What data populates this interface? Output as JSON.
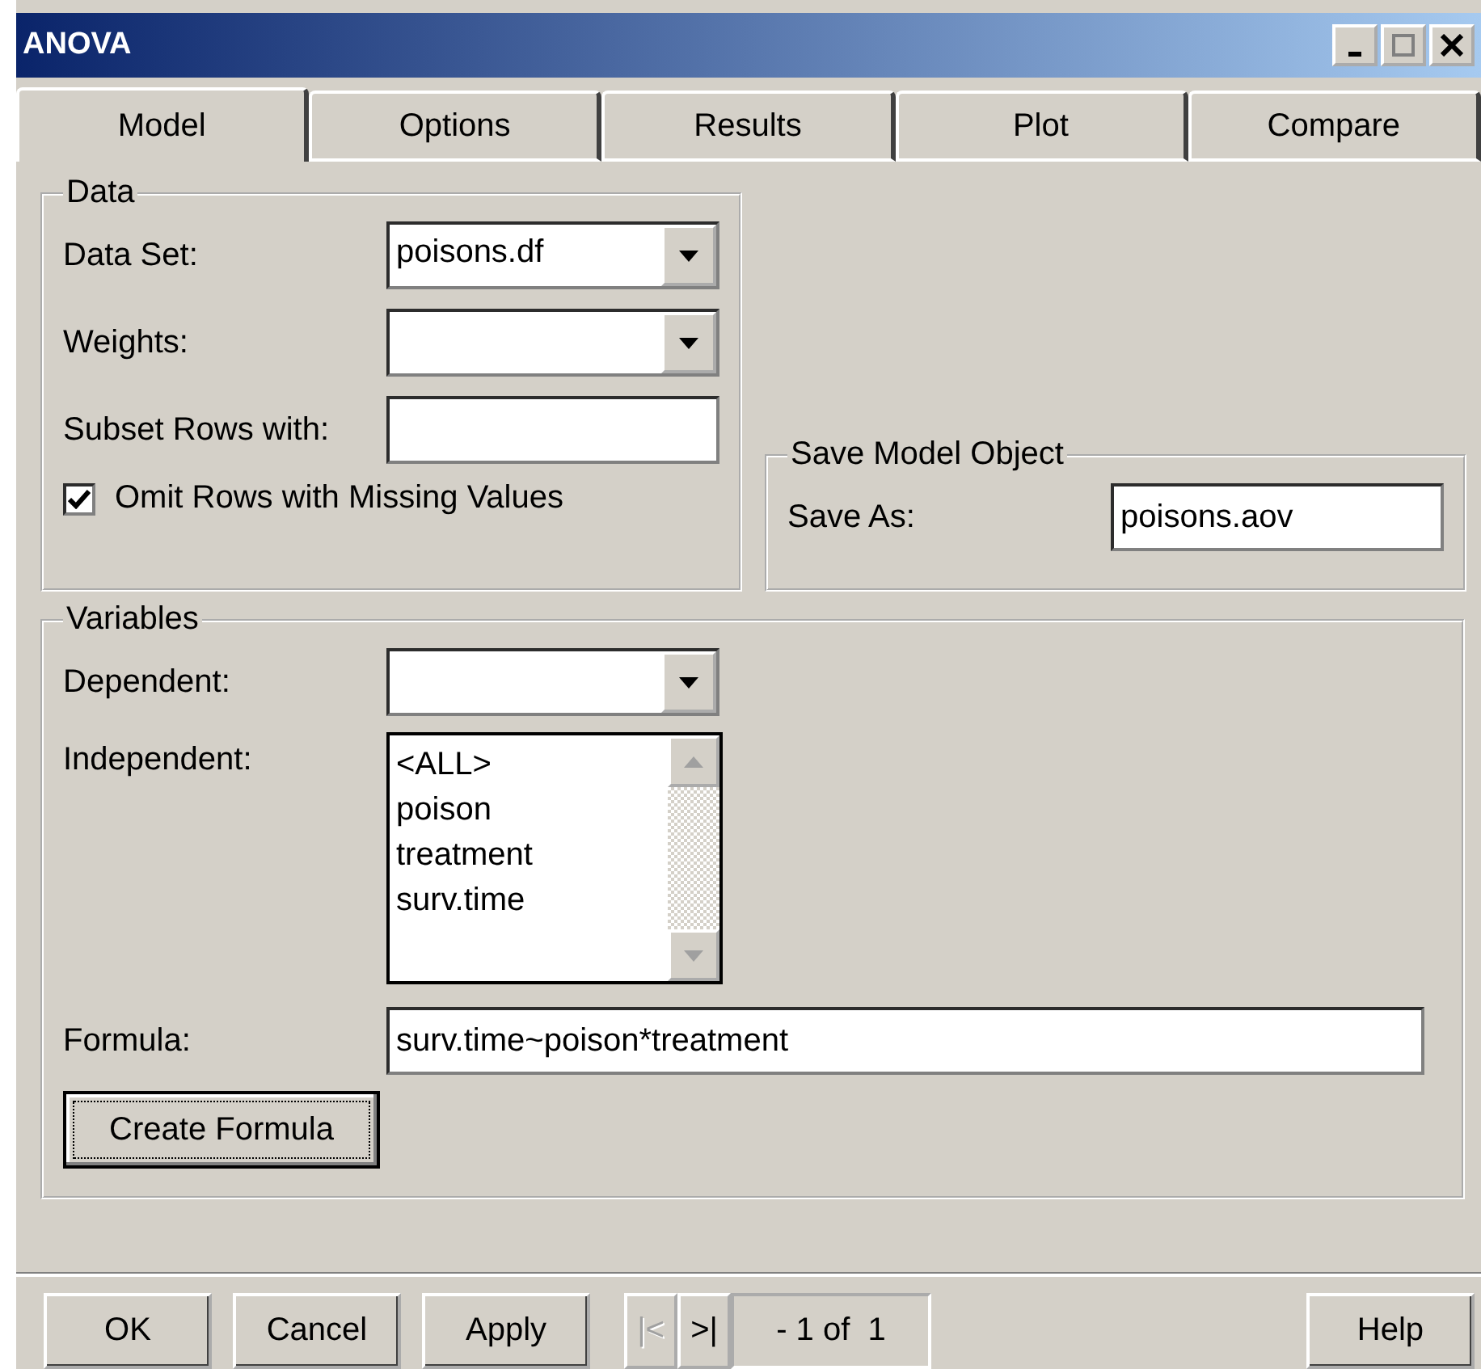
{
  "window": {
    "title": "ANOVA"
  },
  "tabs": [
    {
      "label": "Model",
      "selected": true
    },
    {
      "label": "Options",
      "selected": false
    },
    {
      "label": "Results",
      "selected": false
    },
    {
      "label": "Plot",
      "selected": false
    },
    {
      "label": "Compare",
      "selected": false
    }
  ],
  "data_group": {
    "title": "Data",
    "dataset": {
      "label": "Data Set:",
      "value": "poisons.df"
    },
    "weights": {
      "label": "Weights:"
    },
    "subset": {
      "label": "Subset Rows with:"
    },
    "omit_missing": {
      "label": "Omit Rows with Missing Values",
      "checked": true
    }
  },
  "save_group": {
    "title": "Save Model Object",
    "save_as": {
      "label": "Save As:",
      "value": "poisons.aov"
    }
  },
  "variables_group": {
    "title": "Variables",
    "dependent": {
      "label": "Dependent:"
    },
    "independent": {
      "label": "Independent:",
      "items": [
        {
          "label": "<ALL>",
          "selected": false
        },
        {
          "label": "poison",
          "selected": false
        },
        {
          "label": "treatment",
          "selected": false
        },
        {
          "label": "surv.time",
          "selected": false
        }
      ]
    },
    "formula": {
      "label": "Formula:",
      "value": "surv.time~poison*treatment"
    },
    "create_button": "Create Formula"
  },
  "footer": {
    "buttons": [
      "OK",
      "Cancel",
      "Apply"
    ],
    "nav": [
      {
        "label": "|<",
        "disabled": true
      },
      {
        "label": ">|",
        "disabled": false
      }
    ],
    "page": "- 1 of  1",
    "help": "Help"
  }
}
